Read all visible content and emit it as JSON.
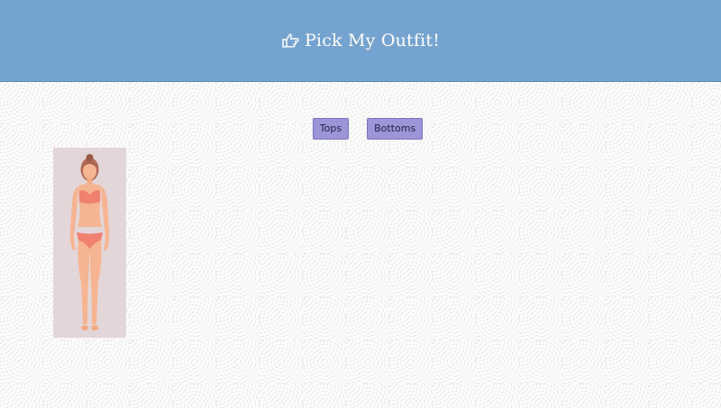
{
  "header": {
    "title": "Pick My Outfit!",
    "icon": "pointing-hand-icon",
    "background": "#75a3cf"
  },
  "buttons": {
    "tops_label": "Tops",
    "bottoms_label": "Bottoms",
    "color": "#9c96d8"
  },
  "figure": {
    "icon": "woman-figure-icon",
    "background": "#e3d6d8"
  }
}
